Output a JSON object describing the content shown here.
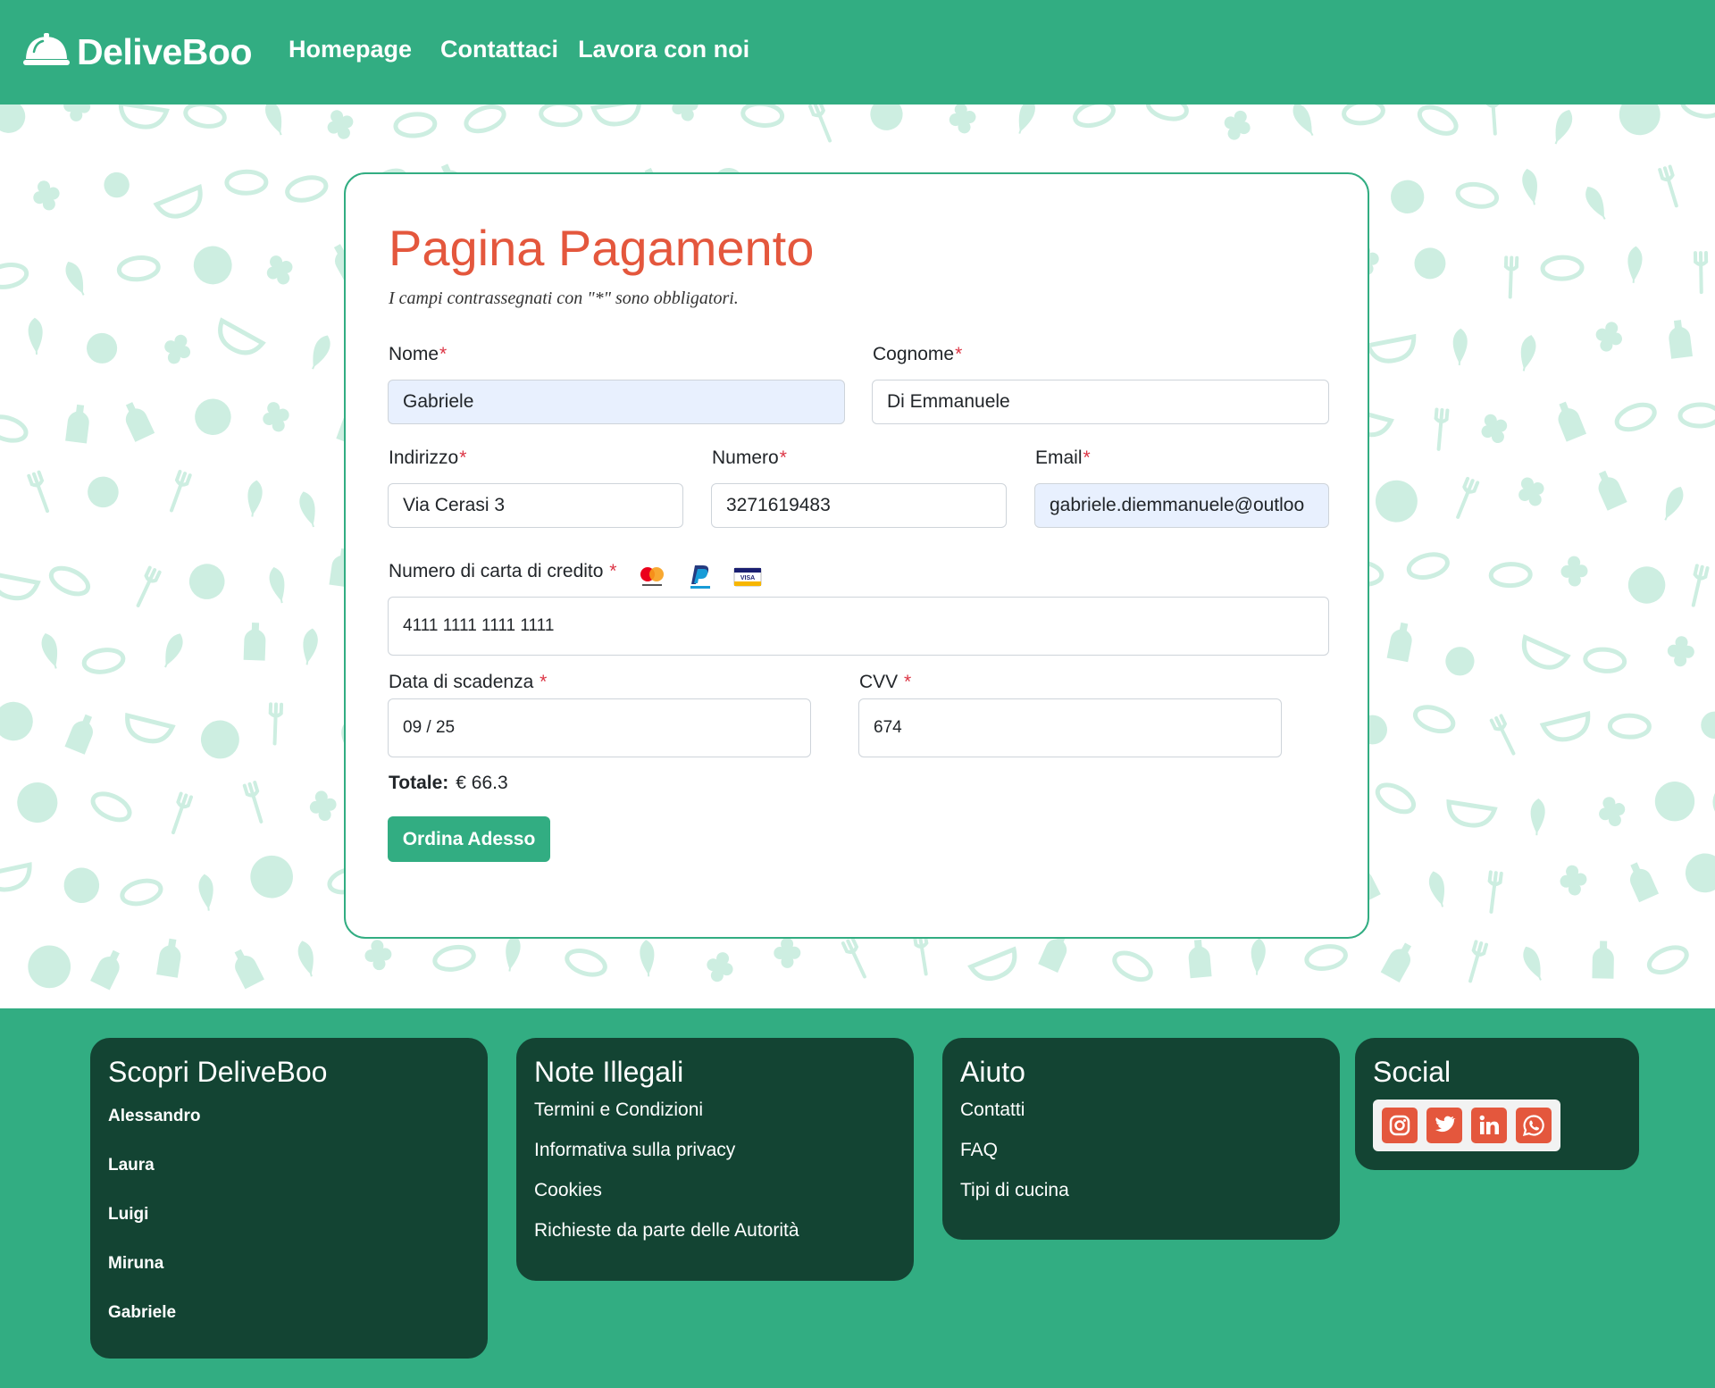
{
  "header": {
    "brand": "DeliveBoo",
    "nav": [
      "Homepage",
      "Contattaci",
      "Lavora con noi"
    ]
  },
  "form": {
    "title": "Pagina Pagamento",
    "note": "I campi contrassegnati con \"*\" sono obbligatori.",
    "required_mark": "*",
    "fields": {
      "nome": {
        "label": "Nome",
        "value": "Gabriele"
      },
      "cognome": {
        "label": "Cognome",
        "value": "Di Emmanuele"
      },
      "indirizzo": {
        "label": "Indirizzo",
        "value": "Via Cerasi 3"
      },
      "numero": {
        "label": "Numero",
        "value": "3271619483"
      },
      "email": {
        "label": "Email",
        "value": "gabriele.diemmanuele@outloo"
      },
      "carta": {
        "label": "Numero di carta di credito ",
        "value": "4111 1111 1111 1111"
      },
      "scadenza": {
        "label": "Data di scadenza ",
        "value": "09 / 25"
      },
      "cvv": {
        "label": "CVV ",
        "value": "674"
      }
    },
    "payment_icons": [
      "mastercard-icon",
      "paypal-icon",
      "visa-icon"
    ],
    "total_label": "Totale:",
    "total_value": "€ 66.3",
    "submit_label": "Ordina Adesso"
  },
  "footer": {
    "discover": {
      "title": "Scopri DeliveBoo",
      "items": [
        "Alessandro",
        "Laura",
        "Luigi",
        "Miruna",
        "Gabriele"
      ]
    },
    "legal": {
      "title": "Note Illegali",
      "items": [
        "Termini e Condizioni",
        "Informativa sulla privacy",
        "Cookies",
        "Richieste da parte delle Autorità"
      ]
    },
    "help": {
      "title": "Aiuto",
      "items": [
        "Contatti",
        "FAQ",
        "Tipi di cucina"
      ]
    },
    "social": {
      "title": "Social",
      "icons": [
        "instagram-icon",
        "twitter-icon",
        "linkedin-icon",
        "whatsapp-icon"
      ]
    }
  },
  "colors": {
    "brand_green": "#32ad82",
    "dark_green": "#134433",
    "accent_orange": "#e4573d",
    "pattern_mint": "#cdeee1"
  }
}
